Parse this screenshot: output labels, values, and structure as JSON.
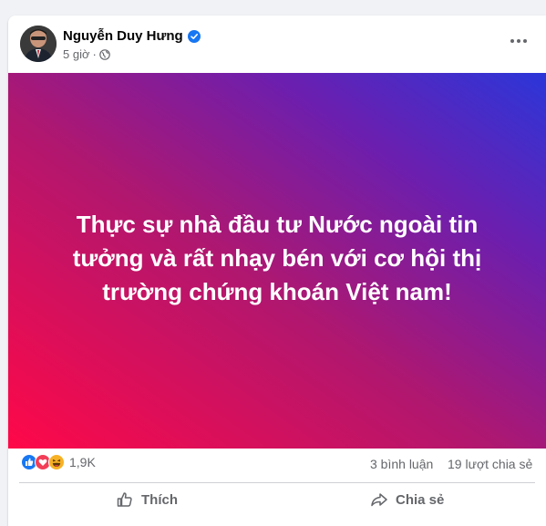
{
  "post": {
    "author": "Nguyễn Duy Hưng",
    "time": "5 giờ",
    "separator": "·",
    "media_text": "Thực sự nhà đầu tư Nước ngoài tin tưởng và rất nhạy bén với cơ hội thị trường chứng khoán Việt nam!",
    "reactions_count": "1,9K",
    "comments": "3 bình luận",
    "shares": "19 lượt chia sẻ",
    "like_label": "Thích",
    "share_label": "Chia sẻ"
  },
  "icons": {
    "verified": "verified-badge-icon",
    "privacy": "globe-icon",
    "more": "more-options-icon",
    "reactions": [
      "like-reaction-icon",
      "love-reaction-icon",
      "haha-reaction-icon"
    ]
  },
  "colors": {
    "gradient_start": "#ff0848",
    "gradient_end": "#2b36d9",
    "secondary_text": "#65676b",
    "verified_blue": "#1877f2"
  }
}
